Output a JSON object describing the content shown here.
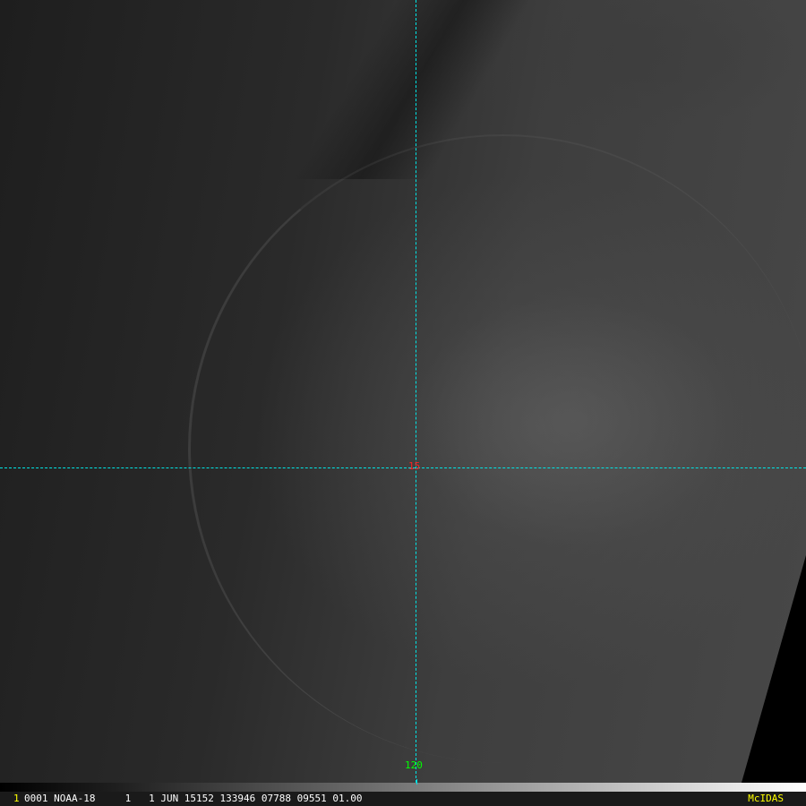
{
  "overlay": {
    "latitude_label": "15",
    "longitude_label": "120",
    "grid_color": "#00e5e5"
  },
  "info_bar": {
    "frame_number": "1",
    "text": "0001 NOAA-18     1   1 JUN 15152 133946 07788 09551 01.00",
    "brand": "McIDAS"
  }
}
